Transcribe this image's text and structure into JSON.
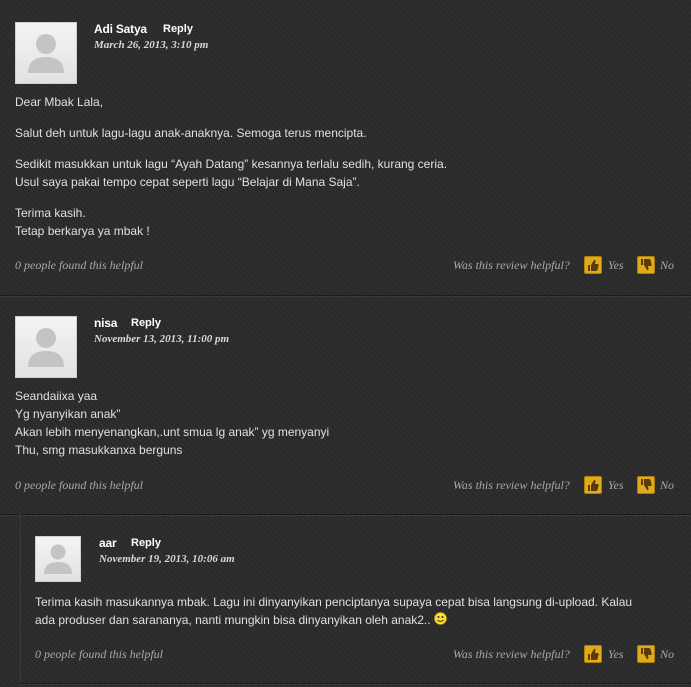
{
  "comments": [
    {
      "author": "Adi Satya",
      "reply_label": "Reply",
      "date": "March 26, 2013, 3:10 pm",
      "paragraphs": [
        [
          "Dear Mbak Lala,"
        ],
        [
          "Salut deh untuk lagu-lagu anak-anaknya. Semoga terus mencipta."
        ],
        [
          "Sedikit masukkan untuk lagu “Ayah Datang” kesannya terlalu sedih, kurang ceria.",
          "Usul saya pakai tempo cepat seperti lagu “Belajar di Mana Saja”."
        ],
        [
          "Terima kasih.",
          "Tetap berkarya ya mbak !"
        ]
      ],
      "helpful_count": "0 people found this helpful",
      "helpful_question": "Was this review helpful?",
      "yes_label": "Yes",
      "no_label": "No"
    },
    {
      "author": "nisa",
      "reply_label": "Reply",
      "date": "November 13, 2013, 11:00 pm",
      "paragraphs": [
        [
          "Seandaiixa yaa",
          "Yg nyanyikan anak”",
          "Akan lebih menyenangkan,.unt smua lg anak” yg menyanyi",
          "Thu, smg masukkanxa berguns"
        ]
      ],
      "helpful_count": "0 people found this helpful",
      "helpful_question": "Was this review helpful?",
      "yes_label": "Yes",
      "no_label": "No"
    },
    {
      "author": "aar",
      "reply_label": "Reply",
      "date": "November 19, 2013, 10:06 am",
      "paragraphs": [
        [
          "Terima kasih masukannya mbak. Lagu ini dinyanyikan penciptanya supaya cepat bisa langsung di-upload. Kalau ada produser dan sarananya, nanti mungkin bisa dinyanyikan oleh anak2.."
        ]
      ],
      "emoticon": "smiley-icon",
      "helpful_count": "0 people found this helpful",
      "helpful_question": "Was this review helpful?",
      "yes_label": "Yes",
      "no_label": "No"
    }
  ],
  "colors": {
    "vote_button": "#e0aa1c",
    "background": "#2b2b2b"
  }
}
